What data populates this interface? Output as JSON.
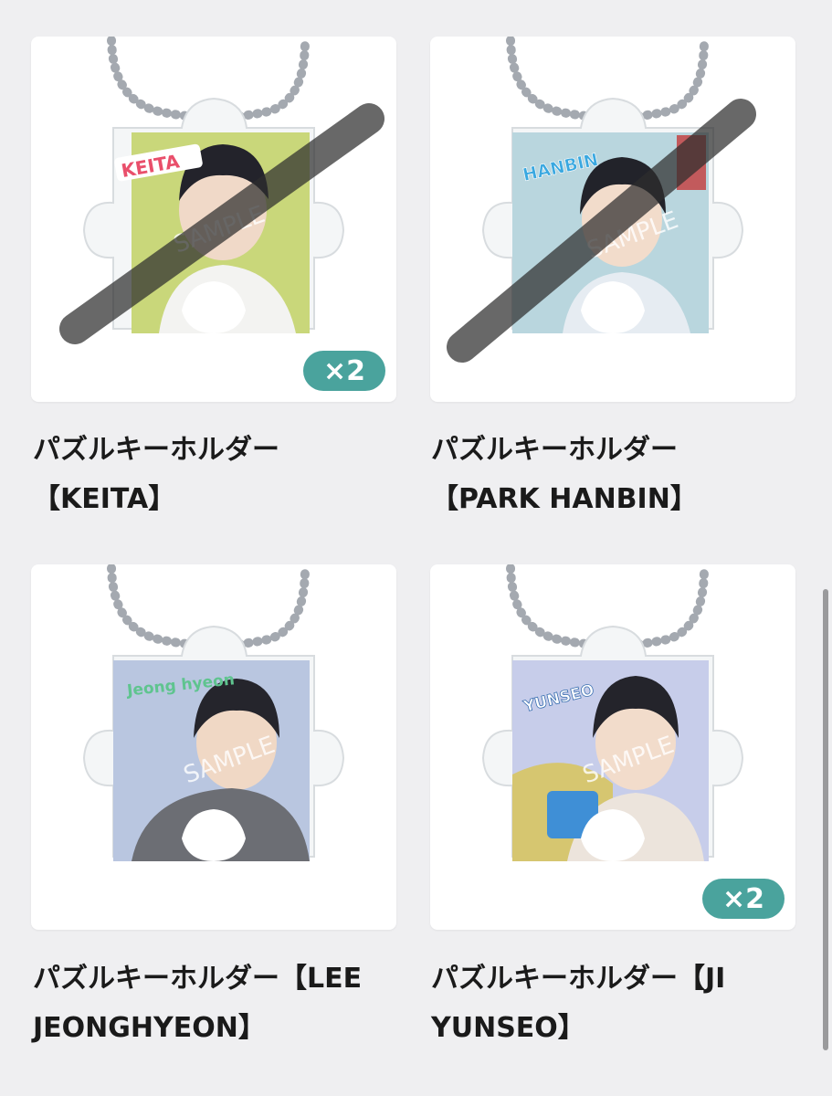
{
  "products": [
    {
      "title_line1": "パズルキーホルダー",
      "title_line2": "【KEITA】",
      "name_tag": "KEITA",
      "sample_text": "SAMPLE",
      "quantity": "×2",
      "accent": "#e94f6b",
      "photo_bg": "#c9d77a",
      "sold_out_mark": true
    },
    {
      "title_line1": "パズルキーホルダー",
      "title_line2": "【PARK HANBIN】",
      "name_tag": "HANBIN",
      "sample_text": "SAMPLE",
      "quantity": "",
      "accent": "#3aa8e0",
      "photo_bg": "#b9d6de",
      "sold_out_mark": true
    },
    {
      "title_line1": "パズルキーホルダー【LEE",
      "title_line2": "JEONGHYEON】",
      "name_tag": "Jeong hyeon",
      "sample_text": "SAMPLE",
      "quantity": "",
      "accent": "#5fc48f",
      "photo_bg": "#b9c6e0",
      "sold_out_mark": false
    },
    {
      "title_line1": "パズルキーホルダー【JI",
      "title_line2": "YUNSEO】",
      "name_tag": "YUNSEO",
      "sample_text": "SAMPLE",
      "quantity": "×2",
      "accent": "#3a6fb0",
      "photo_bg": "#c7cdea",
      "sold_out_mark": false
    }
  ]
}
